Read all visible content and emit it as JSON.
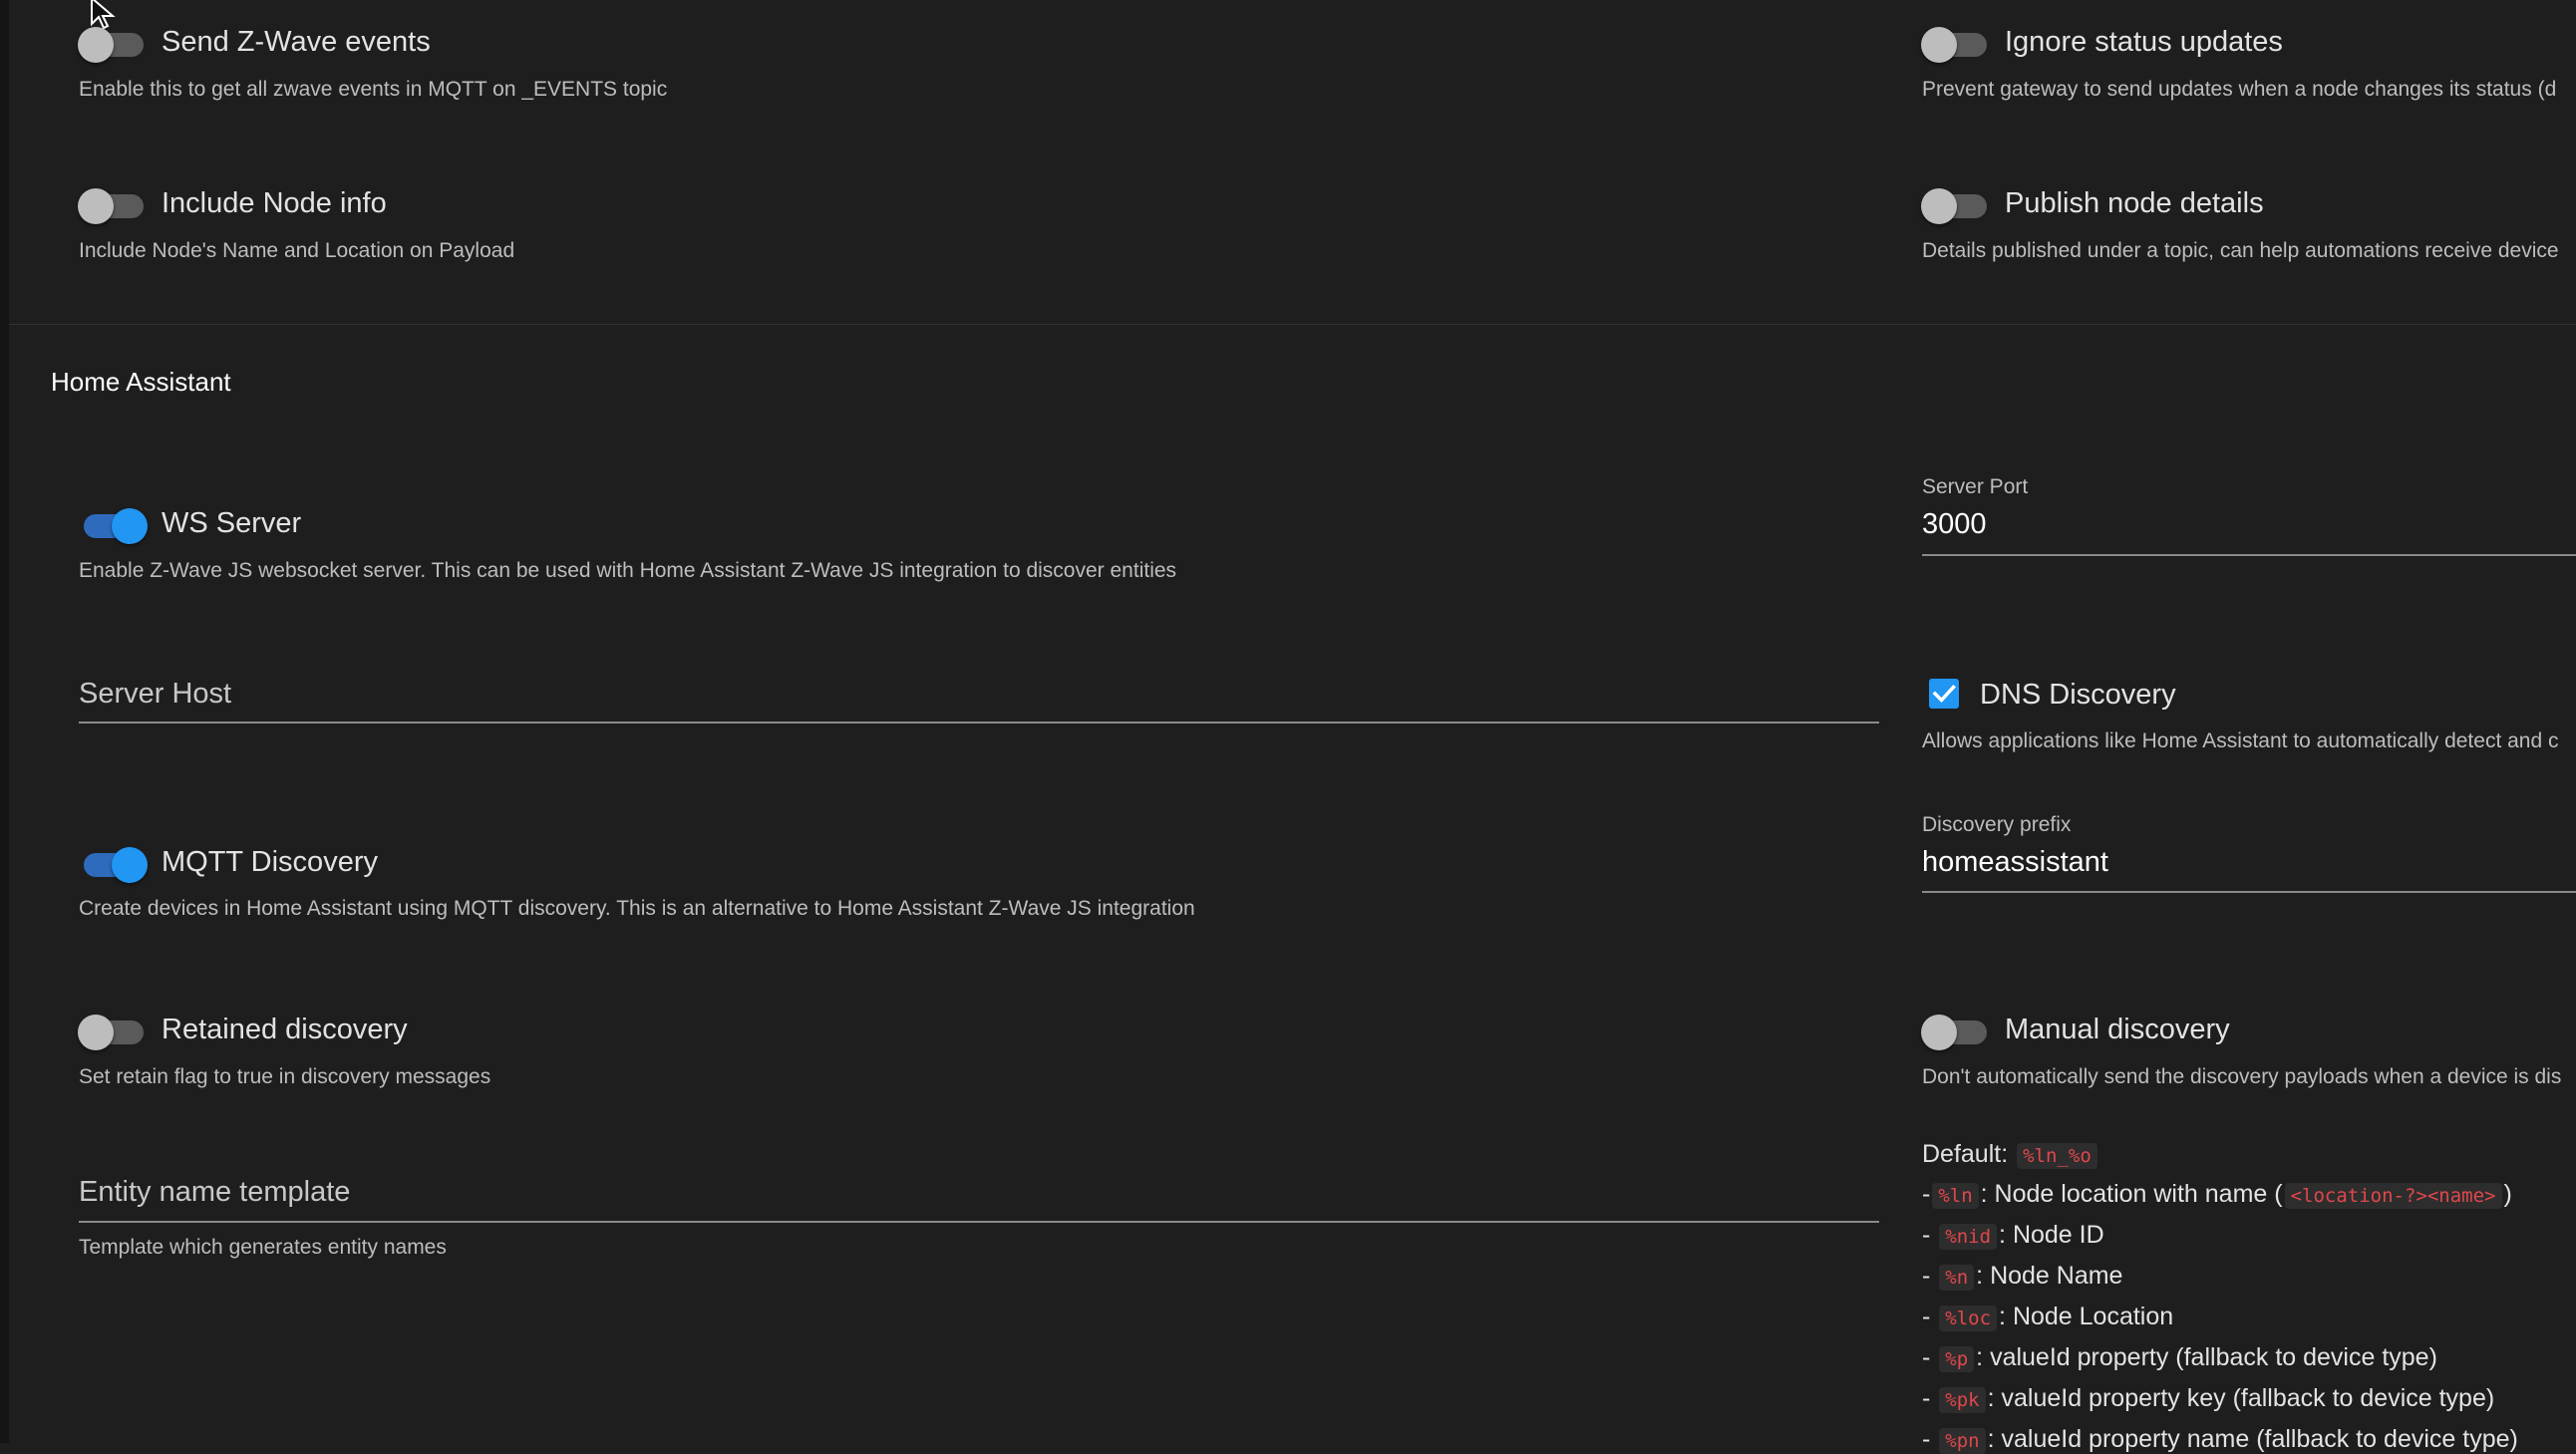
{
  "gateway_toggles": {
    "send_zwave_events": {
      "label": "Send Z-Wave events",
      "hint": "Enable this to get all zwave events in MQTT on _EVENTS topic",
      "on": false
    },
    "ignore_status": {
      "label": "Ignore status updates",
      "hint": "Prevent gateway to send updates when a node changes its status (d",
      "on": false
    },
    "include_node_info": {
      "label": "Include Node info",
      "hint": "Include Node's Name and Location on Payload",
      "on": false
    },
    "publish_node_details": {
      "label": "Publish node details",
      "hint": "Details published under a topic, can help automations receive device",
      "on": false
    }
  },
  "home_assistant": {
    "section_title": "Home Assistant",
    "ws_server": {
      "label": "WS Server",
      "hint": "Enable Z-Wave JS websocket server. This can be used with Home Assistant Z-Wave JS integration to discover entities",
      "on": true
    },
    "server_port": {
      "label": "Server Port",
      "value": "3000"
    },
    "server_host": {
      "placeholder": "Server Host",
      "value": ""
    },
    "dns_discovery": {
      "label": "DNS Discovery",
      "hint": "Allows applications like Home Assistant to automatically detect and c",
      "checked": true
    },
    "mqtt_discovery": {
      "label": "MQTT Discovery",
      "hint": "Create devices in Home Assistant using MQTT discovery. This is an alternative to Home Assistant Z-Wave JS integration",
      "on": true
    },
    "discovery_prefix": {
      "label": "Discovery prefix",
      "value": "homeassistant"
    },
    "retained_discovery": {
      "label": "Retained discovery",
      "hint": "Set retain flag to true in discovery messages",
      "on": false
    },
    "manual_discovery": {
      "label": "Manual discovery",
      "hint": "Don't automatically send the discovery payloads when a device is dis",
      "on": false
    },
    "entity_name_template": {
      "placeholder": "Entity name template",
      "hint": "Template which generates entity names",
      "value": ""
    },
    "template_help": {
      "default_label": "Default:",
      "default_code": "%ln_%o",
      "lines": [
        {
          "prefix": "-",
          "code": "%ln",
          "text": ": Node location with name (",
          "code2": "<location-?><name>",
          "suffix": ")"
        },
        {
          "prefix": "- ",
          "code": "%nid",
          "text": ": Node ID"
        },
        {
          "prefix": "- ",
          "code": "%n",
          "text": ": Node Name"
        },
        {
          "prefix": "- ",
          "code": "%loc",
          "text": ": Node Location"
        },
        {
          "prefix": "- ",
          "code": "%p",
          "text": ": valueId property (fallback to device type)"
        },
        {
          "prefix": "- ",
          "code": "%pk",
          "text": ": valueId property key (fallback to device type)"
        },
        {
          "prefix": "- ",
          "code": "%pn",
          "text": ": valueId property name (fallback to device type)"
        }
      ]
    }
  },
  "icons": {
    "cursor": "mouse-pointer-icon",
    "check": "checkmark-icon"
  },
  "colors": {
    "accent": "#2196f3",
    "background": "#1e1e1e",
    "code": "#e0474c"
  }
}
